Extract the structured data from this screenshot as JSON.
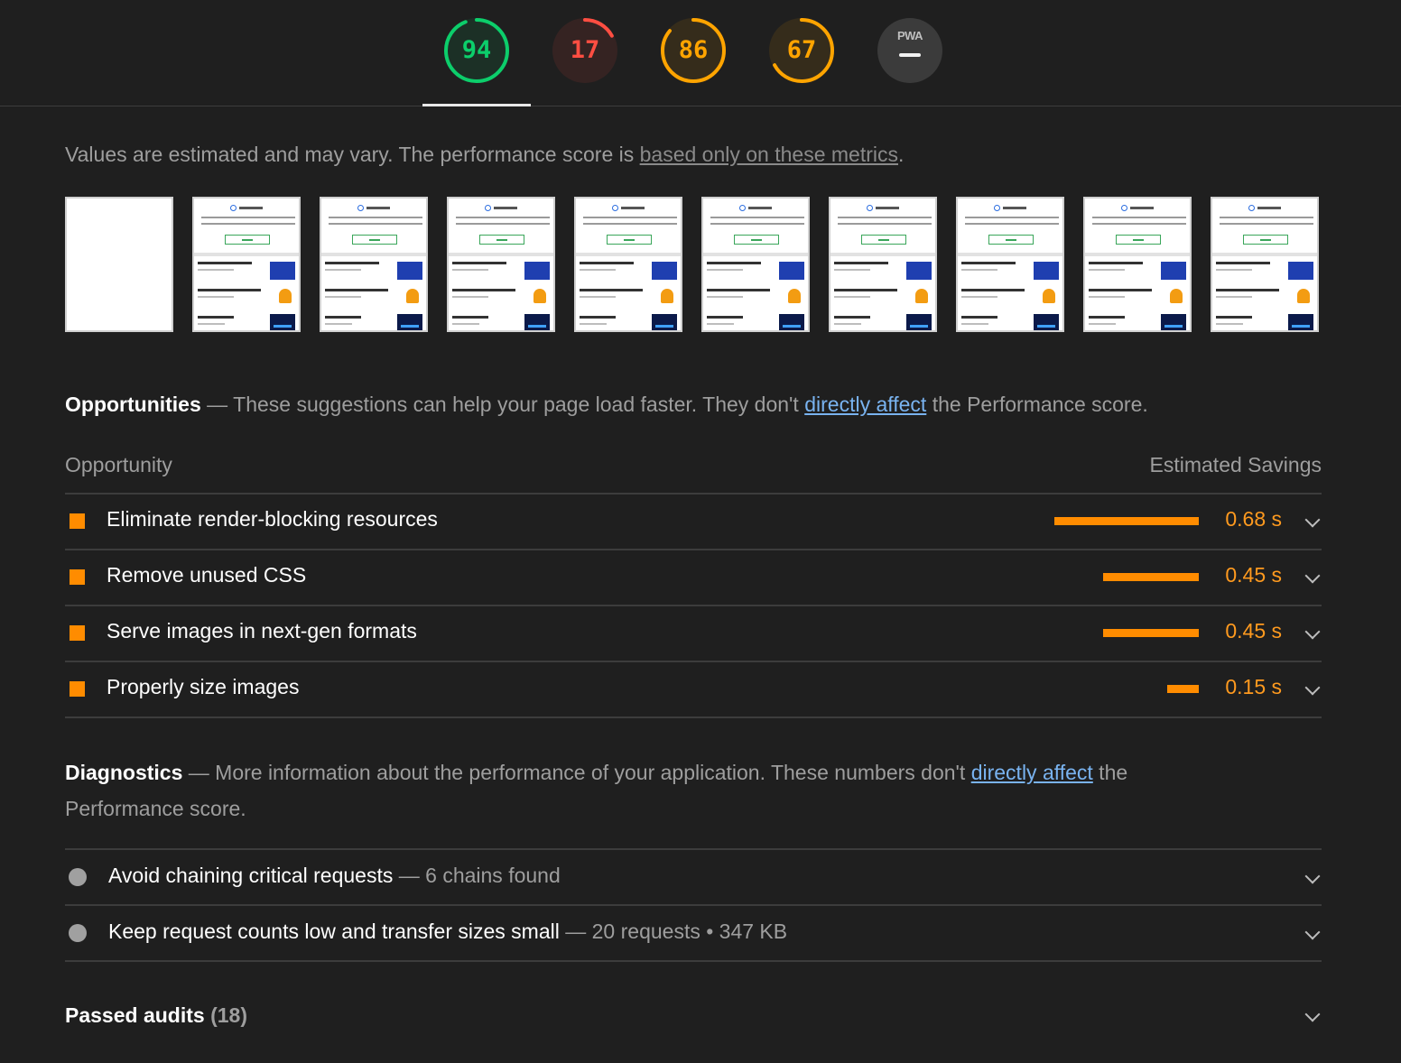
{
  "scores": [
    {
      "name": "performance",
      "value": "94",
      "fraction": 0.94,
      "color": "#0cce6b"
    },
    {
      "name": "accessibility",
      "value": "17",
      "fraction": 0.17,
      "color": "#ff4e42"
    },
    {
      "name": "best-practices",
      "value": "86",
      "fraction": 0.86,
      "color": "#ffa400"
    },
    {
      "name": "seo",
      "value": "67",
      "fraction": 0.67,
      "color": "#ffa400"
    }
  ],
  "pwa": {
    "label": "PWA"
  },
  "note": {
    "text": "Values are estimated and may vary. The performance score is ",
    "link": "based only on these metrics",
    "end": "."
  },
  "opportunities": {
    "heading": "Opportunities",
    "dash": " — ",
    "desc_pre": "These suggestions can help your page load faster. They don't ",
    "link": "directly affect",
    "desc_post": " the Performance score.",
    "col_left": "Opportunity",
    "col_right": "Estimated Savings",
    "items": [
      {
        "title": "Eliminate render-blocking resources",
        "value": "0.68 s",
        "seconds": 0.68
      },
      {
        "title": "Remove unused CSS",
        "value": "0.45 s",
        "seconds": 0.45
      },
      {
        "title": "Serve images in next-gen formats",
        "value": "0.45 s",
        "seconds": 0.45
      },
      {
        "title": "Properly size images",
        "value": "0.15 s",
        "seconds": 0.15
      }
    ]
  },
  "diagnostics": {
    "heading": "Diagnostics",
    "dash": " — ",
    "desc_pre": "More information about the performance of your application. These numbers don't ",
    "link": "directly affect",
    "desc_post": " the",
    "desc_line2": "Performance score.",
    "items": [
      {
        "title": "Avoid chaining critical requests",
        "dash": " — ",
        "detail": "6 chains found"
      },
      {
        "title": "Keep request counts low and transfer sizes small",
        "dash": " — ",
        "detail": "20 requests • 347 KB"
      }
    ]
  },
  "passed": {
    "label": "Passed audits",
    "count": "(18)"
  },
  "colors": {
    "accent_orange": "#ff8c00",
    "link_blue": "#79b3f0",
    "background": "#1f1f1f"
  }
}
